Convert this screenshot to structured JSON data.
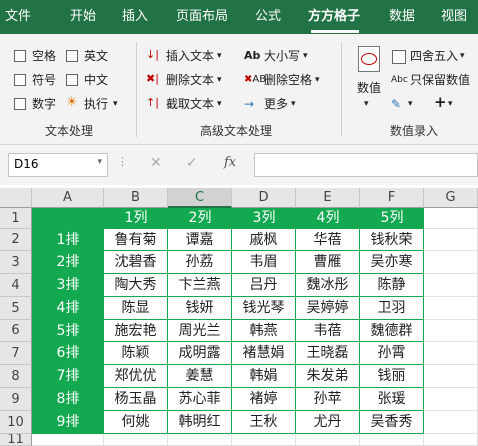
{
  "tabs": [
    "文件",
    "开始",
    "插入",
    "页面布局",
    "公式",
    "方方格子",
    "数据",
    "视图"
  ],
  "text_group": {
    "label": "文本处理",
    "options": [
      "空格",
      "英文",
      "符号",
      "中文",
      "数字"
    ],
    "execute": "执行"
  },
  "advanced_group": {
    "label": "高级文本处理",
    "insert": "插入文本",
    "delete": "删除文本",
    "extract": "截取文本",
    "case": "大小写",
    "delete_space": "删除空格",
    "more": "更多"
  },
  "numeric_group": {
    "label": "数值录入",
    "value": "数值",
    "round": "四舍五入",
    "keep_value": "只保留数值"
  },
  "formula_bar": {
    "name_box": "D16",
    "fx": "fx",
    "cancel": "✕",
    "confirm": "✓"
  },
  "sheet": {
    "columns": [
      "A",
      "B",
      "C",
      "D",
      "E",
      "F",
      "G"
    ],
    "rows": [
      "1",
      "2",
      "3",
      "4",
      "5",
      "6",
      "7",
      "8",
      "9",
      "10",
      "11"
    ],
    "header_row": [
      "",
      "1列",
      "2列",
      "3列",
      "4列",
      "5列"
    ],
    "row_labels": [
      "1排",
      "2排",
      "3排",
      "4排",
      "5排",
      "6排",
      "7排",
      "8排",
      "9排"
    ],
    "data": [
      [
        "鲁有菊",
        "谭嘉",
        "戚枫",
        "华蓓",
        "钱秋荣"
      ],
      [
        "沈碧香",
        "孙荔",
        "韦眉",
        "曹雁",
        "吴亦寒"
      ],
      [
        "陶大秀",
        "卞兰燕",
        "吕丹",
        "魏冰彤",
        "陈静"
      ],
      [
        "陈显",
        "钱妍",
        "钱光琴",
        "吴婷婷",
        "卫羽"
      ],
      [
        "施宏艳",
        "周光兰",
        "韩燕",
        "韦蓓",
        "魏德群"
      ],
      [
        "陈颖",
        "成明露",
        "褚慧娟",
        "王晓磊",
        "孙霄"
      ],
      [
        "郑优优",
        "姜慧",
        "韩娟",
        "朱发弟",
        "钱丽"
      ],
      [
        "杨玉晶",
        "苏心菲",
        "褚婷",
        "孙苹",
        "张瑗"
      ],
      [
        "何姚",
        "韩明红",
        "王秋",
        "尤丹",
        "吴香秀"
      ]
    ]
  },
  "colors": {
    "ribbon_tab": "#217346",
    "accent_green": "#13a951"
  }
}
